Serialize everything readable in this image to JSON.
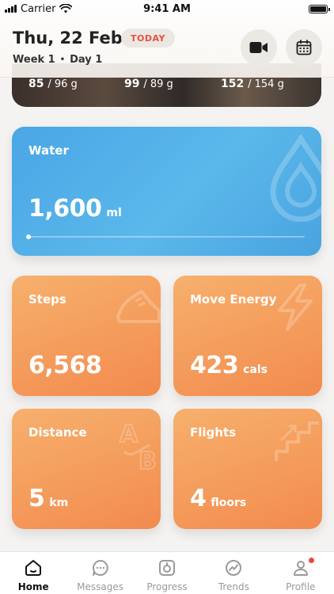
{
  "status_bar": {
    "carrier": "Carrier",
    "time": "9:41 AM"
  },
  "header": {
    "date": "Thu, 22 Feb",
    "badge": "TODAY",
    "week": "Week 1",
    "separator": "•",
    "day": "Day 1",
    "buttons": [
      "video-camera-icon",
      "calendar-icon"
    ]
  },
  "macros": [
    {
      "value": "85",
      "target": "/ 96 g"
    },
    {
      "value": "99",
      "target": "/ 89 g"
    },
    {
      "value": "152",
      "target": "/ 154 g"
    }
  ],
  "water": {
    "label": "Water",
    "value": "1,600",
    "unit": "ml",
    "progress": 0,
    "icon": "water-drop-icon",
    "color": "#4aa6e6"
  },
  "tiles": {
    "steps": {
      "label": "Steps",
      "value": "6,568",
      "unit": "",
      "icon": "sneaker-icon"
    },
    "energy": {
      "label": "Move Energy",
      "value": "423",
      "unit": "cals",
      "icon": "lightning-icon"
    },
    "distance": {
      "label": "Distance",
      "value": "5",
      "unit": "km",
      "icon": "a-to-b-icon"
    },
    "flights": {
      "label": "Flights",
      "value": "4",
      "unit": "floors",
      "icon": "stairs-icon"
    },
    "color": "#f49a5a"
  },
  "tabbar": {
    "tabs": [
      {
        "label": "Home",
        "icon": "home-icon",
        "active": true
      },
      {
        "label": "Messages",
        "icon": "chat-icon",
        "active": false
      },
      {
        "label": "Progress",
        "icon": "scale-icon",
        "active": false
      },
      {
        "label": "Trends",
        "icon": "trends-icon",
        "active": false
      },
      {
        "label": "Profile",
        "icon": "profile-icon",
        "active": false,
        "notification": true
      }
    ],
    "notification_color": "#f0473c"
  }
}
